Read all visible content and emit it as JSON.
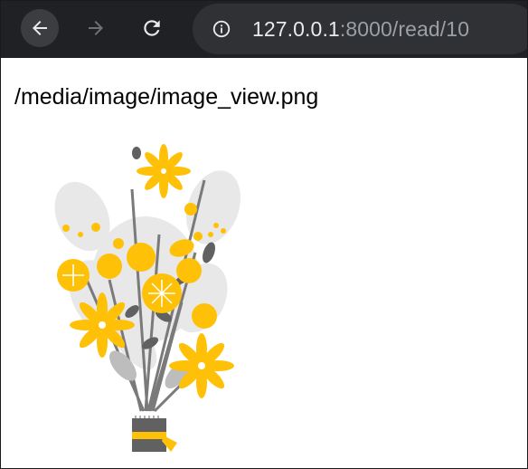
{
  "browser": {
    "back_icon": "arrow-left-icon",
    "forward_icon": "arrow-right-icon",
    "reload_icon": "reload-icon",
    "site_info_icon": "info-circle-icon",
    "url_host": "127.0.0.1",
    "url_rest": ":8000/read/10"
  },
  "page": {
    "path_text": "/media/image/image_view.png",
    "image_subject": "flower bouquet illustration"
  },
  "colors": {
    "toolbar": "#202124",
    "omnibox": "#303134",
    "flower_yellow": "#ffc107",
    "stem_gray": "#616161",
    "leaf_light": "#e0e0e0"
  }
}
